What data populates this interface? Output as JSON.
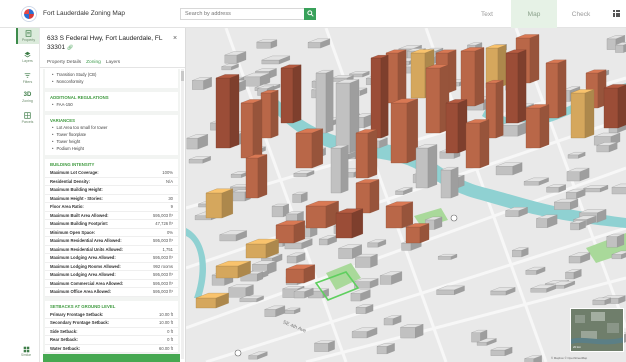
{
  "header": {
    "app_title": "Fort Lauderdale Zoning Map",
    "search_placeholder": "Search by address",
    "tabs": [
      {
        "label": "Text",
        "active": false
      },
      {
        "label": "Map",
        "active": true
      },
      {
        "label": "Check",
        "active": false
      }
    ]
  },
  "rail": {
    "items": [
      {
        "label": "Property",
        "icon": "property-icon",
        "active": true
      },
      {
        "label": "Layers",
        "icon": "layers-icon",
        "active": false
      },
      {
        "label": "Filters",
        "icon": "filters-icon",
        "active": false
      },
      {
        "label": "Zoning",
        "icon": "3d-icon",
        "glyph": "3D",
        "active": false
      },
      {
        "label": "Parcels",
        "icon": "parcels-icon",
        "active": false
      }
    ],
    "bottom_label": "Similar"
  },
  "panel": {
    "address_line1": "633 S Federal Hwy, Fort Lauderdale, FL",
    "address_line2": "33301",
    "tabs": [
      {
        "label": "Property Details",
        "active": false
      },
      {
        "label": "Zoning",
        "active": true
      },
      {
        "label": "Layers",
        "active": false
      }
    ],
    "top_bullets": [
      "Transition Study (CB)",
      "Nonconformity"
    ],
    "additional_regulations": {
      "title": "ADDITIONAL REGULATIONS",
      "items": [
        "FAA-150"
      ]
    },
    "variances": {
      "title": "VARIANCES",
      "items": [
        "Lot Area too small for tower",
        "Tower floorplate",
        "Tower height",
        "Podium Height"
      ]
    },
    "building_intensity": {
      "title": "BUILDING INTENSITY",
      "rows": [
        {
          "k": "Maximum Lot Coverage:",
          "v": "100%"
        },
        {
          "k": "Residential Density:",
          "v": "N/A"
        },
        {
          "k": "Maximum Building Height:",
          "v": ""
        },
        {
          "k": "Maximum Height - Stories:",
          "v": "30"
        },
        {
          "k": "Floor Area Ratio:",
          "v": "9"
        },
        {
          "k": "Maximum Built Area Allowed:",
          "v": "595,003 ft²"
        },
        {
          "k": "Maximum Building Footprint:",
          "v": "47,726 ft²"
        },
        {
          "k": "Minimum Open Space:",
          "v": "0%"
        },
        {
          "k": "Maximum Residential Area Allowed:",
          "v": "595,003 ft²"
        },
        {
          "k": "Maximum Residential Units Allowed:",
          "v": "1,751"
        },
        {
          "k": "Maximum Lodging Area Allowed:",
          "v": "595,003 ft²"
        },
        {
          "k": "Maximum Lodging Rooms Allowed:",
          "v": "992 rooms"
        },
        {
          "k": "Maximum Lodging Area Allowed:",
          "v": "595,003 ft²"
        },
        {
          "k": "Maximum Commercial Area Allowed:",
          "v": "595,003 ft²"
        },
        {
          "k": "Maximum Office Area Allowed:",
          "v": "595,003 ft²"
        }
      ]
    },
    "setbacks": {
      "title": "SETBACKS AT GROUND LEVEL",
      "rows": [
        {
          "k": "Primary Frontage Setback:",
          "v": "10.00 ft"
        },
        {
          "k": "Secondary Frontage Setback:",
          "v": "10.00 ft"
        },
        {
          "k": "Side Setback:",
          "v": "0 ft"
        },
        {
          "k": "Rear Setback:",
          "v": "0 ft"
        },
        {
          "k": "Water Setback:",
          "v": "60.00 ft"
        }
      ]
    }
  },
  "map": {
    "street_label": "SE 4th Ave",
    "minimap_label": "20 km",
    "attribution": "© Mapbox © OpenStreetMap",
    "colors": {
      "ground": "#e9e9e9",
      "building_gray": "#d2d2d2",
      "building_orange": "#c9704e",
      "building_tan": "#e7b565",
      "building_brown": "#a8543c",
      "water": "#8fd1d2",
      "park": "#a9d99a"
    }
  }
}
